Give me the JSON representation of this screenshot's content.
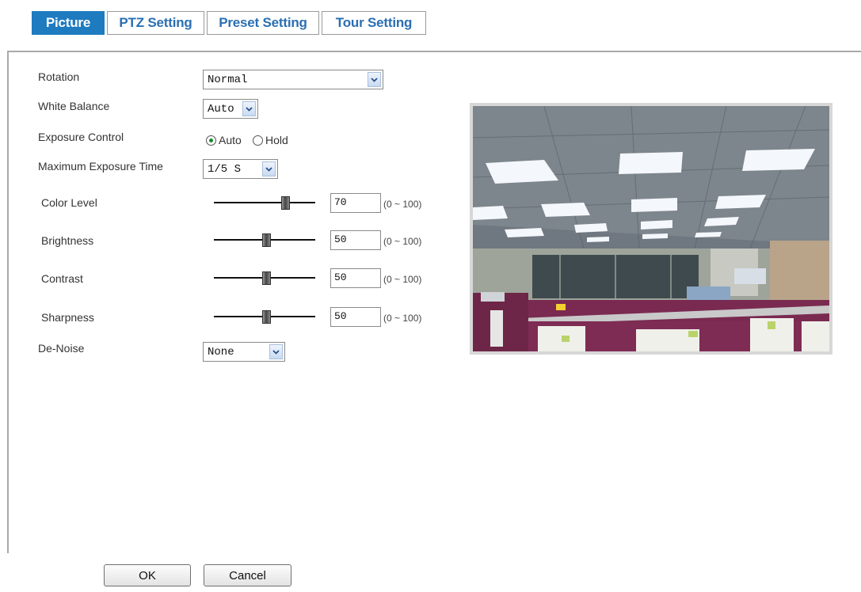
{
  "tabs": [
    {
      "label": "Picture",
      "active": true
    },
    {
      "label": "PTZ Setting",
      "active": false
    },
    {
      "label": "Preset Setting",
      "active": false
    },
    {
      "label": "Tour Setting",
      "active": false
    }
  ],
  "settings": {
    "rotation": {
      "label": "Rotation",
      "value": "Normal"
    },
    "white_balance": {
      "label": "White Balance",
      "value": "Auto"
    },
    "exposure_control": {
      "label": "Exposure Control",
      "options": [
        "Auto",
        "Hold"
      ],
      "selected": "Auto"
    },
    "max_exposure_time": {
      "label": "Maximum Exposure Time",
      "value": "1/5 S"
    },
    "color_level": {
      "label": "Color Level",
      "value": "70",
      "range": "(0 ~ 100)"
    },
    "brightness": {
      "label": "Brightness",
      "value": "50",
      "range": "(0 ~ 100)"
    },
    "contrast": {
      "label": "Contrast",
      "value": "50",
      "range": "(0 ~ 100)"
    },
    "sharpness": {
      "label": "Sharpness",
      "value": "50",
      "range": "(0 ~ 100)"
    },
    "de_noise": {
      "label": "De-Noise",
      "value": "None"
    }
  },
  "buttons": {
    "ok": "OK",
    "cancel": "Cancel"
  },
  "colors": {
    "tab_active_bg": "#1f7bc0",
    "tab_text": "#2a6fb2",
    "radio_dot": "#1a8a2a"
  }
}
